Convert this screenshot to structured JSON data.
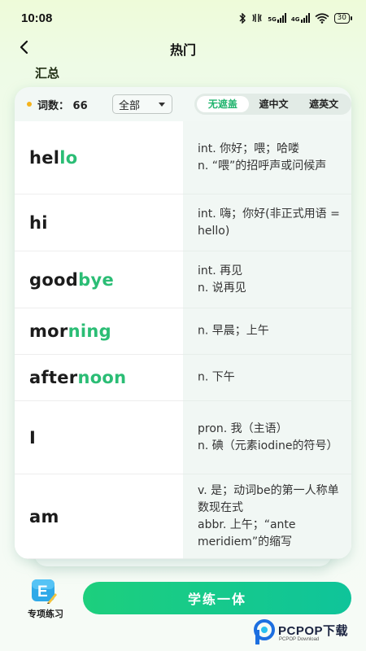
{
  "status_bar": {
    "time": "10:08",
    "bluetooth_icon": "bluetooth-icon",
    "network_5g": "5G",
    "network_4g": "4G",
    "battery": "30"
  },
  "header": {
    "title": "热门",
    "back_icon": "chevron-left-icon"
  },
  "section": {
    "title": "汇总"
  },
  "toolbar": {
    "count_label": "词数：",
    "count_value": "66",
    "filter_selected": "全部",
    "segments": [
      "无遮盖",
      "遮中文",
      "遮英文"
    ],
    "active_segment": 0
  },
  "words": [
    {
      "prefix": "hel",
      "highlight": "lo",
      "meaning": "int. 你好；喂；哈喽\nn. “喂”的招呼声或问候声"
    },
    {
      "prefix": "hi",
      "highlight": "",
      "meaning": "int. 嗨；你好(非正式用语 = hello)"
    },
    {
      "prefix": "good",
      "highlight": "bye",
      "meaning": "int. 再见\n n. 说再见"
    },
    {
      "prefix": "mor",
      "highlight": "ning",
      "meaning": "n. 早晨；上午"
    },
    {
      "prefix": "after",
      "highlight": "noon",
      "meaning": "n. 下午"
    },
    {
      "prefix": "I",
      "highlight": "",
      "meaning": "pron. 我（主语）\nn. 碘（元素iodine的符号）"
    },
    {
      "prefix": "am",
      "highlight": "",
      "meaning": "v. 是；动词be的第一人称单数现在式\n abbr. 上午；“ante meridiem”的缩写"
    }
  ],
  "bottom": {
    "special_practice_label": "专项练习",
    "main_button_label": "学练一体"
  },
  "watermark": {
    "text": "PCPOP下载",
    "sub": "PCPOP Download"
  },
  "colors": {
    "accent": "#2bbd75",
    "button_start": "#1dcf7d",
    "button_end": "#0fc49a",
    "count_dot": "#f5b31c"
  }
}
